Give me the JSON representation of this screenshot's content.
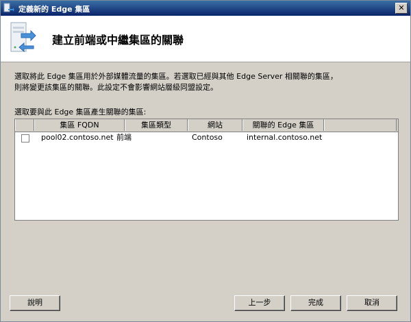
{
  "window": {
    "title": "定義新的 Edge 集區",
    "close_glyph": "✕"
  },
  "header": {
    "title": "建立前端或中繼集區的關聯"
  },
  "description": {
    "line1": "選取將此 Edge 集區用於外部媒體流量的集區。若選取已經與其他 Edge Server 相關聯的集區，",
    "line2": "則將變更該集區的關聯。此設定不會影響網站層級同盟設定。"
  },
  "list": {
    "label": "選取要與此 Edge 集區產生關聯的集區:",
    "columns": [
      "集區 FQDN",
      "集區類型",
      "網站",
      "關聯的 Edge 集區"
    ],
    "rows": [
      {
        "checked": false,
        "fqdn": "pool02.contoso.net",
        "type": "前端",
        "site": "Contoso",
        "edge_pool": "internal.contoso.net"
      }
    ]
  },
  "buttons": {
    "help": "說明",
    "back": "上一步",
    "finish": "完成",
    "cancel": "取消"
  }
}
